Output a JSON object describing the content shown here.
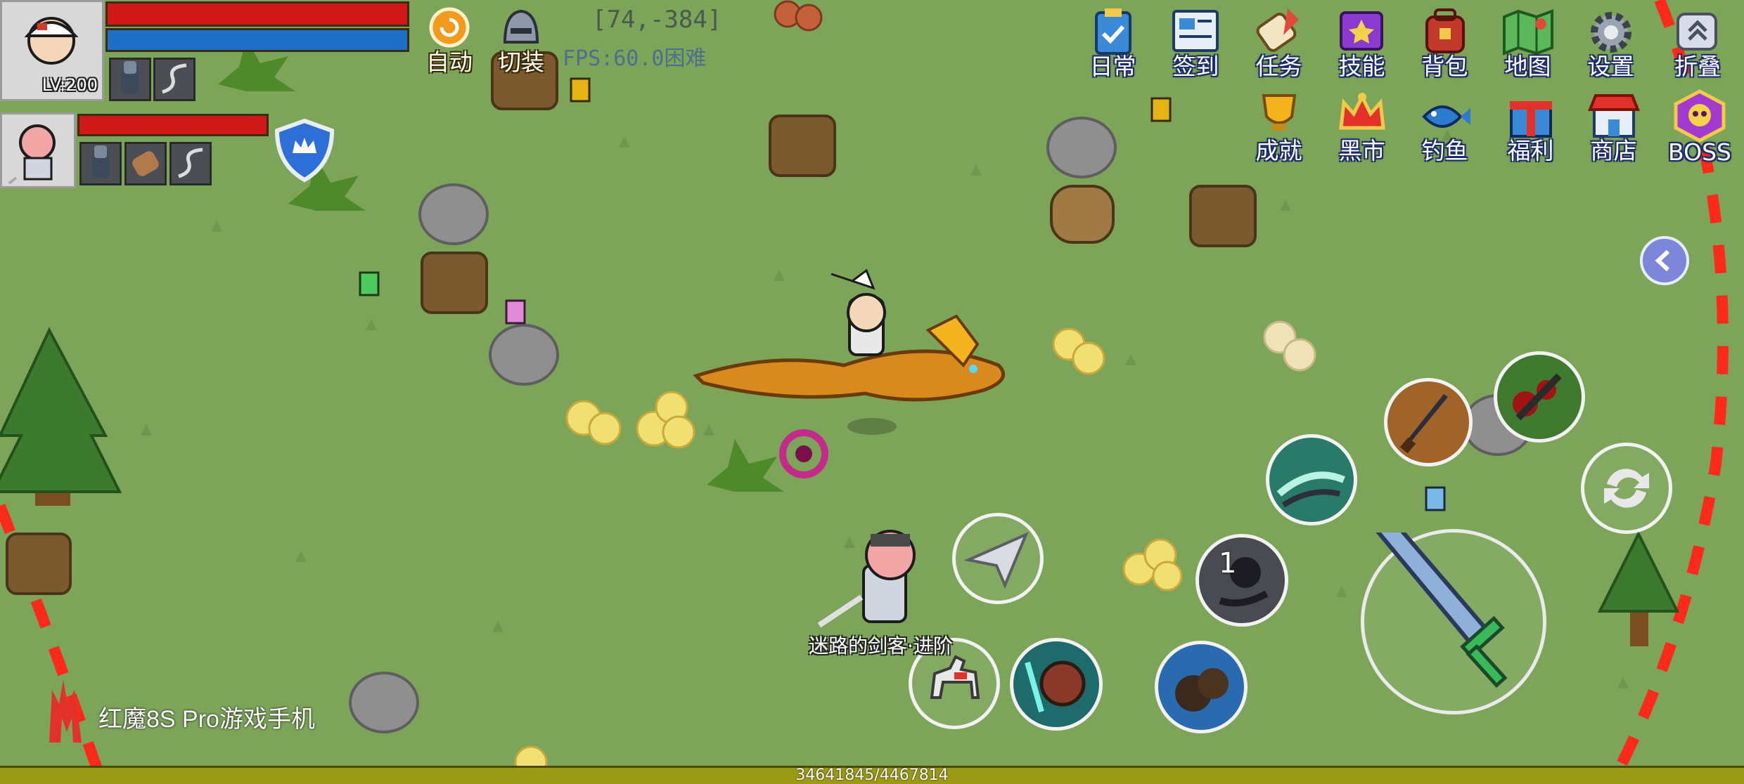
{
  "hud": {
    "player": {
      "level": "LV:200"
    },
    "auto_label": "自动",
    "equip_label": "切装",
    "coordinates": "[74,-384]",
    "fps_difficulty": "FPS:60.0困难"
  },
  "menu": {
    "row1": [
      "日常",
      "签到",
      "任务",
      "技能",
      "背包",
      "地图",
      "设置",
      "折叠"
    ],
    "row2": [
      "成就",
      "黑市",
      "钓鱼",
      "福利",
      "商店",
      "BOSS"
    ]
  },
  "skills": {
    "cooldown_count": "1"
  },
  "npc": {
    "name": "迷路的剑客·进阶"
  },
  "exp": {
    "text": "34641845/4467814"
  },
  "watermark": {
    "brand": "红魔8S Pro游戏手机"
  },
  "colors": {
    "grass": "#7da55a",
    "hp": "#d01818",
    "mp": "#1f6fc8",
    "exp": "#9a9a14",
    "boundary": "#ff2a1a",
    "collapse_arrow": "#7d86d8"
  }
}
